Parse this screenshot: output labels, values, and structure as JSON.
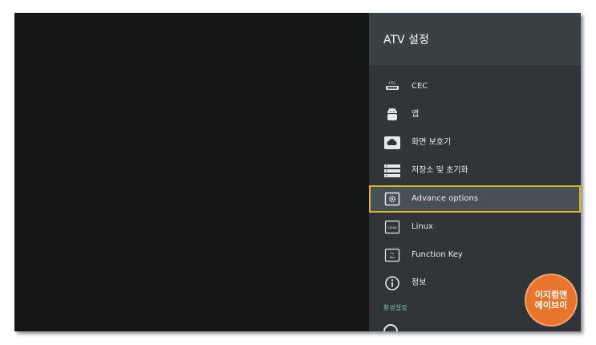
{
  "panel": {
    "title": "ATV 설정",
    "items": [
      {
        "label": "CEC",
        "icon": "cec-hdmi-icon"
      },
      {
        "label": "앱",
        "icon": "android-icon"
      },
      {
        "label": "화면 보호기",
        "icon": "screensaver-cloud-icon"
      },
      {
        "label": "저장소 및 초기화",
        "icon": "storage-icon"
      },
      {
        "label": "Advance options",
        "icon": "gear-icon",
        "selected": true
      },
      {
        "label": "Linux",
        "icon": "linux-box-icon"
      },
      {
        "label": "Function Key",
        "icon": "function-key-icon"
      },
      {
        "label": "정보",
        "icon": "info-icon"
      }
    ],
    "section_header": "환경설정"
  },
  "watermark": {
    "text": "이지컴앤\n에이브이"
  },
  "colors": {
    "panel_bg": "#2f3538",
    "header_bg": "#3a4144",
    "selection_outline": "#d8b52a",
    "section_header": "#7fc4aa",
    "watermark_bg": "#e9742d"
  }
}
